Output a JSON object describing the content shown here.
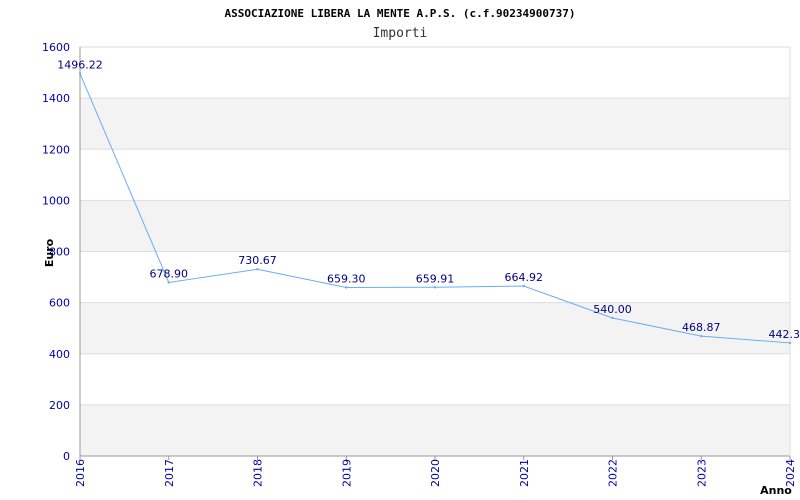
{
  "chart_data": {
    "type": "line",
    "title": "ASSOCIAZIONE LIBERA LA MENTE A.P.S. (c.f.90234900737)",
    "subtitle": "Importi",
    "xlabel": "Anno",
    "ylabel": "Euro",
    "x": [
      "2016",
      "2017",
      "2018",
      "2019",
      "2020",
      "2021",
      "2022",
      "2023",
      "2024"
    ],
    "values": [
      1496.22,
      678.9,
      730.67,
      659.3,
      659.91,
      664.92,
      540.0,
      468.87,
      442.3
    ],
    "data_labels": [
      "1496.22",
      "678.90",
      "730.67",
      "659.30",
      "659.91",
      "664.92",
      "540.00",
      "468.87",
      "442.3"
    ],
    "ylim": [
      0,
      1600
    ],
    "yticks": [
      "0",
      "200",
      "400",
      "600",
      "800",
      "1000",
      "1200",
      "1400",
      "1600"
    ],
    "grid": true,
    "colors": {
      "line": "#6aaef0",
      "band": "#f3f3f3",
      "grid": "#dddddd",
      "tick_text": "#0000aa",
      "label_text": "#000080"
    }
  }
}
